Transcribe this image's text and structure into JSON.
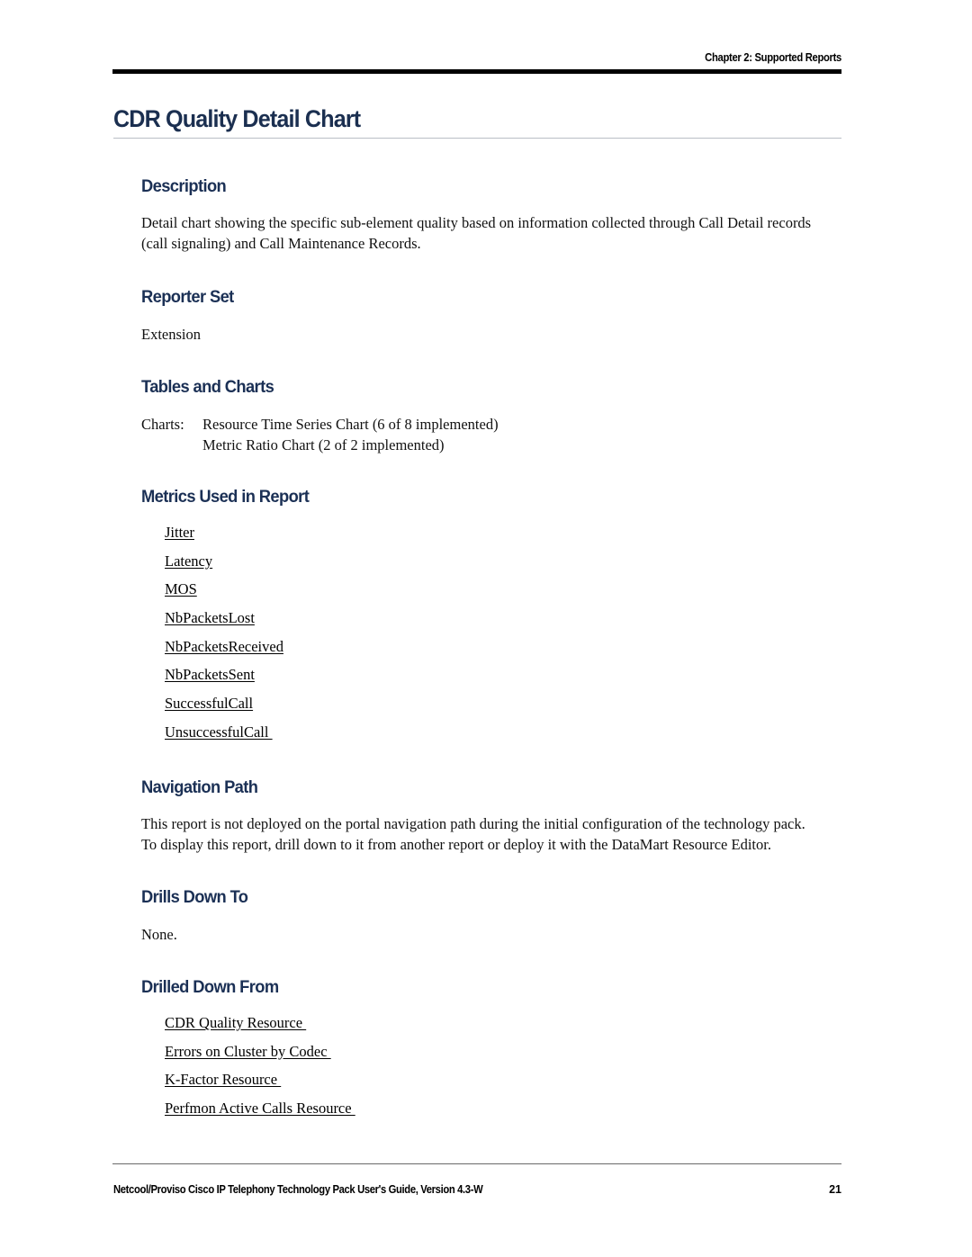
{
  "header": {
    "chapter": "Chapter 2: Supported Reports"
  },
  "title": "CDR Quality Detail Chart",
  "sections": {
    "description": {
      "heading": "Description",
      "lines": [
        "Detail chart showing the specific sub-element quality based on information collected through Call Detail records",
        "(call signaling) and Call Maintenance Records."
      ]
    },
    "reporter_set": {
      "heading": "Reporter Set",
      "value": "Extension"
    },
    "tables_and_charts": {
      "heading": "Tables and Charts",
      "label": "Charts:",
      "items": [
        "Resource Time Series Chart (6 of 8 implemented)",
        "Metric Ratio Chart (2 of 2 implemented)"
      ]
    },
    "metrics_used": {
      "heading": "Metrics Used in Report",
      "links": [
        "Jitter",
        "Latency",
        "MOS",
        "NbPacketsLost",
        "NbPacketsReceived",
        "NbPacketsSent",
        "SuccessfulCall",
        "UnsuccessfulCall "
      ]
    },
    "navigation_path": {
      "heading": "Navigation Path",
      "lines": [
        "This report is not deployed on the portal navigation path during the initial configuration of the technology pack.",
        "To display this report, drill down to it from another report or deploy it with the DataMart Resource Editor."
      ]
    },
    "drills_down_to": {
      "heading": "Drills Down To",
      "value": "None."
    },
    "drilled_down_from": {
      "heading": "Drilled Down From",
      "links": [
        "CDR Quality Resource ",
        "Errors on Cluster by Codec ",
        "K-Factor Resource ",
        "Perfmon Active Calls Resource "
      ]
    }
  },
  "footer": {
    "text": "Netcool/Proviso Cisco IP Telephony Technology Pack User's Guide, Version 4.3-W",
    "page": "21"
  },
  "colors": {
    "heading_navy": "#1b3055",
    "title_navy": "#1b2f50",
    "body_black": "#111111",
    "rule_gray": "#b9bec6"
  }
}
